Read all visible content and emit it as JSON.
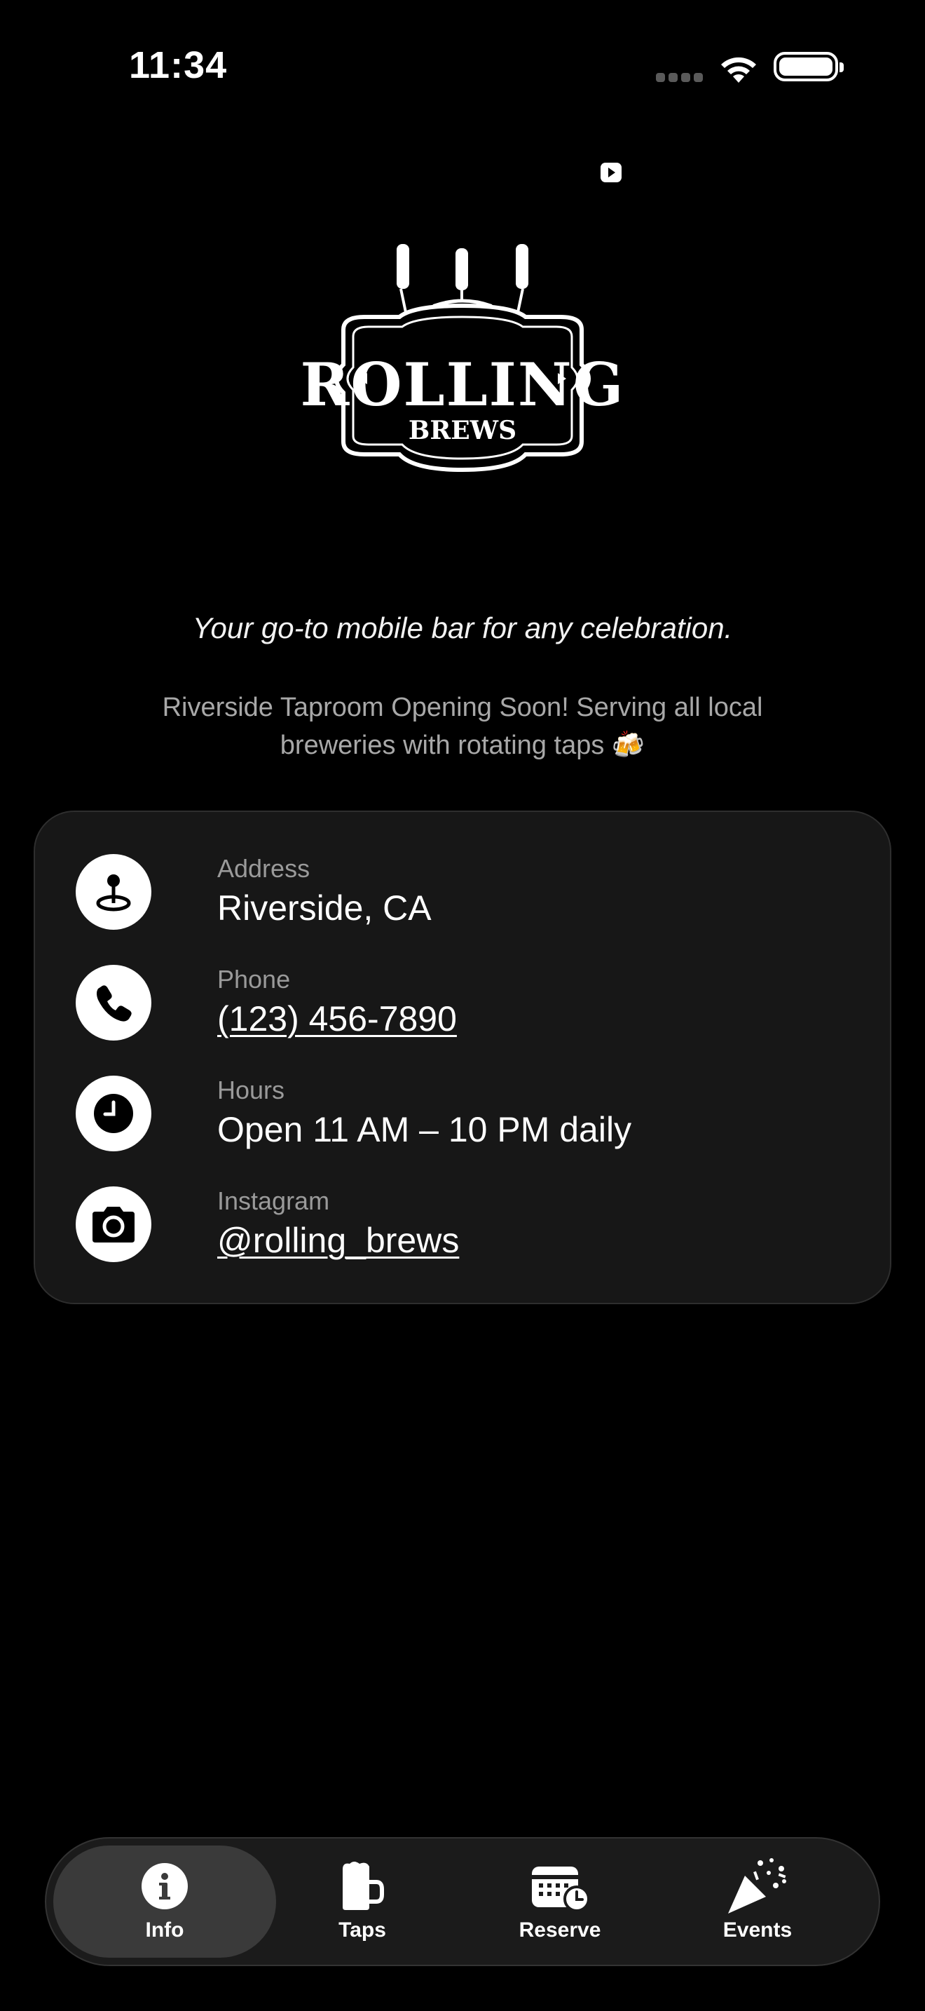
{
  "status_bar": {
    "time": "11:34"
  },
  "logo": {
    "line1": "ROLLING",
    "line2": "BREWS"
  },
  "tagline": "Your go-to mobile bar for any celebration.",
  "announcement": "Riverside Taproom Opening Soon! Serving all local breweries with rotating taps 🍻",
  "info": {
    "address": {
      "label": "Address",
      "value": "Riverside, CA",
      "icon": "map-pin-icon"
    },
    "phone": {
      "label": "Phone",
      "value": "(123) 456-7890",
      "icon": "phone-icon"
    },
    "hours": {
      "label": "Hours",
      "value": "Open 11 AM – 10 PM daily",
      "icon": "clock-icon"
    },
    "instagram": {
      "label": "Instagram",
      "value": "@rolling_brews",
      "icon": "camera-icon"
    }
  },
  "tabs": [
    {
      "label": "Info",
      "icon": "info-icon",
      "active": true
    },
    {
      "label": "Taps",
      "icon": "beer-mug-icon",
      "active": false
    },
    {
      "label": "Reserve",
      "icon": "calendar-clock-icon",
      "active": false
    },
    {
      "label": "Events",
      "icon": "party-popper-icon",
      "active": false
    }
  ],
  "colors": {
    "background": "#000000",
    "card": "#171717",
    "tab_active": "#3a3a3a",
    "muted_text": "#a8a8a8"
  }
}
